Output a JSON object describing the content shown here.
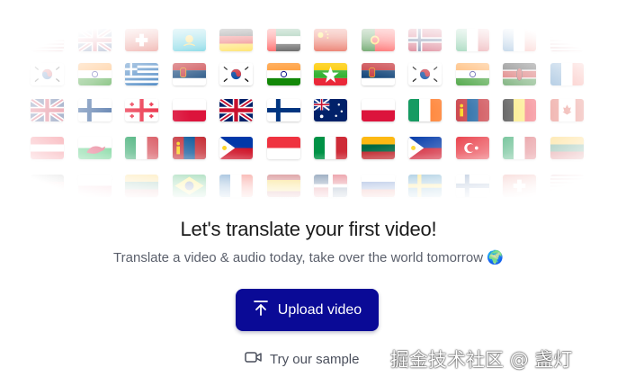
{
  "hero": {
    "title": "Let's translate your first video!",
    "subtitle": "Translate a video & audio today, take over the world tomorrow",
    "subtitle_emoji": "🌍"
  },
  "actions": {
    "upload_label": "Upload video",
    "upload_icon": "upload-arrow-icon",
    "sample_label": "Try our sample",
    "sample_icon": "video-camera-icon"
  },
  "colors": {
    "primary": "#0a0a96",
    "text": "#1a1a1a",
    "muted": "#5a5f6b"
  },
  "flag_wall": {
    "icon": "country-flag",
    "rows": [
      [
        "us",
        "uk",
        "ch",
        "kz",
        "de",
        "ae",
        "cn",
        "pt",
        "no",
        "it",
        "fr",
        "us"
      ],
      [
        "kr",
        "in",
        "gr",
        "rs",
        "kr",
        "in",
        "mm",
        "rs",
        "kr",
        "in",
        "ke",
        "fr"
      ],
      [
        "uk",
        "fi",
        "ge",
        "pl",
        "uk",
        "fi",
        "au",
        "pl",
        "ie",
        "mn",
        "be",
        "ca"
      ],
      [
        "at",
        "wales",
        "it",
        "mn",
        "ph",
        "sg",
        "it",
        "lt",
        "ph",
        "tr",
        "it",
        "lt"
      ],
      [
        "de",
        "pl",
        "lt",
        "br",
        "fr",
        "es",
        "do",
        "ru",
        "se",
        "fi",
        "ch",
        "us"
      ]
    ]
  },
  "watermark": "掘金技术社区 @ 盏灯"
}
